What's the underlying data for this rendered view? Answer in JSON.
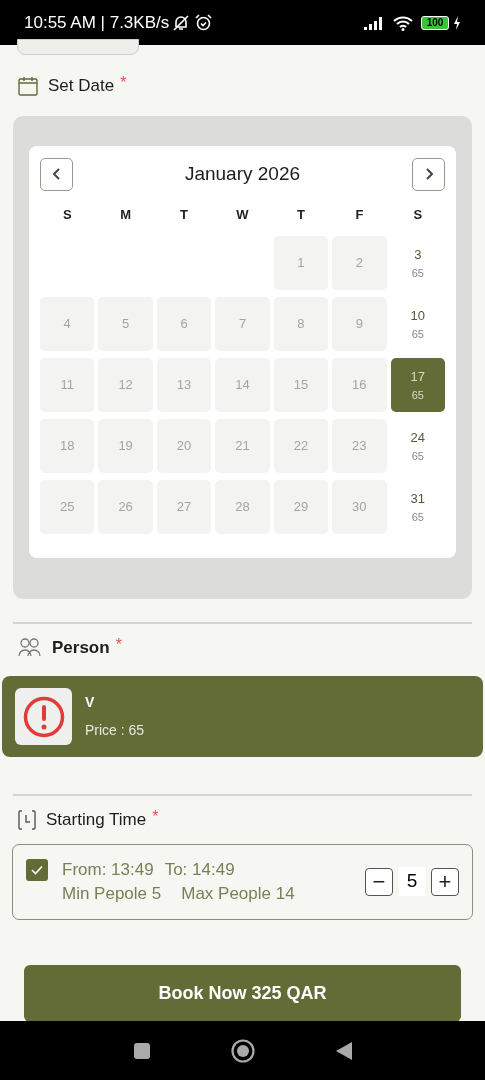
{
  "status_bar": {
    "time": "10:55 AM | 7.3KB/s",
    "battery": "100"
  },
  "set_date": {
    "label": "Set Date",
    "required": "*"
  },
  "calendar": {
    "month": "January 2026",
    "weekdays": [
      "S",
      "M",
      "T",
      "W",
      "T",
      "F",
      "S"
    ],
    "days": [
      {
        "kind": "blank"
      },
      {
        "kind": "blank"
      },
      {
        "kind": "blank"
      },
      {
        "kind": "blank"
      },
      {
        "kind": "day",
        "day": "1",
        "disabled": true,
        "selected": false
      },
      {
        "kind": "day",
        "day": "2",
        "disabled": true,
        "selected": false
      },
      {
        "kind": "day",
        "day": "3",
        "price": "65",
        "disabled": false,
        "selected": false
      },
      {
        "kind": "day",
        "day": "4",
        "disabled": true,
        "selected": false
      },
      {
        "kind": "day",
        "day": "5",
        "disabled": true,
        "selected": false
      },
      {
        "kind": "day",
        "day": "6",
        "disabled": true,
        "selected": false
      },
      {
        "kind": "day",
        "day": "7",
        "disabled": true,
        "selected": false
      },
      {
        "kind": "day",
        "day": "8",
        "disabled": true,
        "selected": false
      },
      {
        "kind": "day",
        "day": "9",
        "disabled": true,
        "selected": false
      },
      {
        "kind": "day",
        "day": "10",
        "price": "65",
        "disabled": false,
        "selected": false
      },
      {
        "kind": "day",
        "day": "11",
        "disabled": true,
        "selected": false
      },
      {
        "kind": "day",
        "day": "12",
        "disabled": true,
        "selected": false
      },
      {
        "kind": "day",
        "day": "13",
        "disabled": true,
        "selected": false
      },
      {
        "kind": "day",
        "day": "14",
        "disabled": true,
        "selected": false
      },
      {
        "kind": "day",
        "day": "15",
        "disabled": true,
        "selected": false
      },
      {
        "kind": "day",
        "day": "16",
        "disabled": true,
        "selected": false
      },
      {
        "kind": "day",
        "day": "17",
        "price": "65",
        "disabled": false,
        "selected": true
      },
      {
        "kind": "day",
        "day": "18",
        "disabled": true,
        "selected": false
      },
      {
        "kind": "day",
        "day": "19",
        "disabled": true,
        "selected": false
      },
      {
        "kind": "day",
        "day": "20",
        "disabled": true,
        "selected": false
      },
      {
        "kind": "day",
        "day": "21",
        "disabled": true,
        "selected": false
      },
      {
        "kind": "day",
        "day": "22",
        "disabled": true,
        "selected": false
      },
      {
        "kind": "day",
        "day": "23",
        "disabled": true,
        "selected": false
      },
      {
        "kind": "day",
        "day": "24",
        "price": "65",
        "disabled": false,
        "selected": false
      },
      {
        "kind": "day",
        "day": "25",
        "disabled": true,
        "selected": false
      },
      {
        "kind": "day",
        "day": "26",
        "disabled": true,
        "selected": false
      },
      {
        "kind": "day",
        "day": "27",
        "disabled": true,
        "selected": false
      },
      {
        "kind": "day",
        "day": "28",
        "disabled": true,
        "selected": false
      },
      {
        "kind": "day",
        "day": "29",
        "disabled": true,
        "selected": false
      },
      {
        "kind": "day",
        "day": "30",
        "disabled": true,
        "selected": false
      },
      {
        "kind": "day",
        "day": "31",
        "price": "65",
        "disabled": false,
        "selected": false
      }
    ]
  },
  "person": {
    "label": "Person",
    "required": "*",
    "option": {
      "name": "V",
      "price": "Price : 65",
      "selected": true
    }
  },
  "starting_time": {
    "label": "Starting Time",
    "required": "*",
    "slot": {
      "checked": true,
      "from": "From: 13:49",
      "to": "To: 14:49",
      "min": "Min Pepole 5",
      "max": "Max People 14",
      "minus": "−",
      "count": "5",
      "plus": "+"
    }
  },
  "book_button": "Book Now 325 QAR"
}
